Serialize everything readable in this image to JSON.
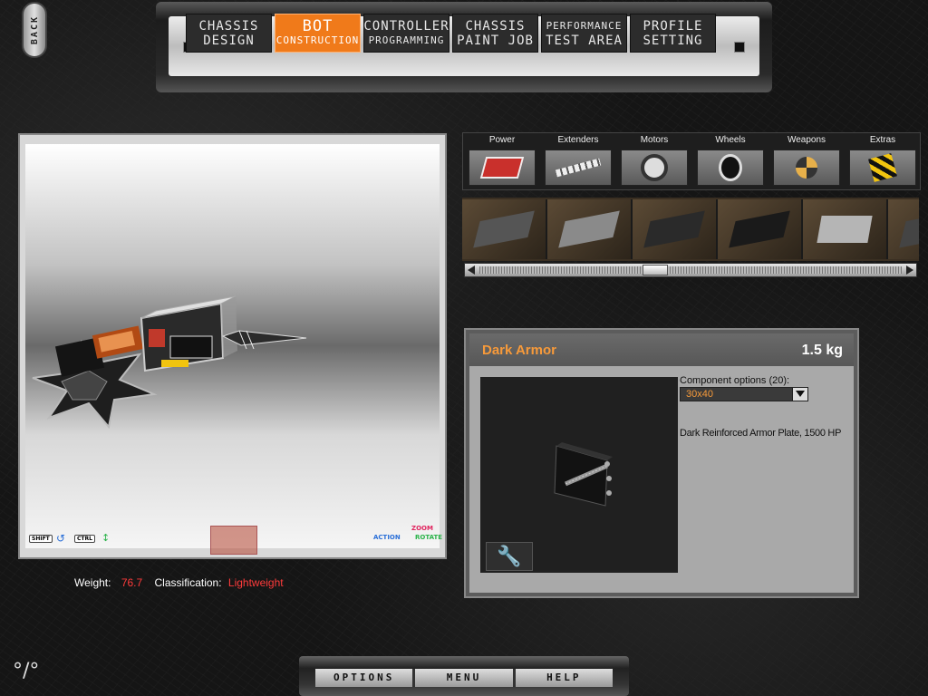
{
  "back": {
    "label": "BACK"
  },
  "nav": {
    "tabs": [
      {
        "line1": "CHASSIS",
        "line2": "DESIGN"
      },
      {
        "line1": "BOT",
        "line2": "CONSTRUCTION",
        "active": true
      },
      {
        "line1": "CONTROLLER",
        "line2": "PROGRAMMING"
      },
      {
        "line1": "CHASSIS",
        "line2": "PAINT JOB"
      },
      {
        "line1": "PERFORMANCE",
        "line2": "TEST AREA"
      },
      {
        "line1": "PROFILE",
        "line2": "SETTING"
      }
    ]
  },
  "viewport": {
    "hints": {
      "shift": "SHIFT",
      "ctrl": "CTRL",
      "action": "ACTION",
      "zoom": "ZOOM",
      "rotate": "ROTATE"
    }
  },
  "stats": {
    "weight_label": "Weight:",
    "weight_value": "76.7",
    "class_label": "Classification:",
    "class_value": "Lightweight"
  },
  "categories": [
    {
      "label": "Power",
      "icon": "battery-icon"
    },
    {
      "label": "Extenders",
      "icon": "extender-icon"
    },
    {
      "label": "Motors",
      "icon": "motor-icon"
    },
    {
      "label": "Wheels",
      "icon": "wheel-icon"
    },
    {
      "label": "Weapons",
      "icon": "saw-icon"
    },
    {
      "label": "Extras",
      "icon": "hazard-icon"
    }
  ],
  "part": {
    "name": "Dark Armor",
    "mass": "1.5 kg",
    "options_label": "Component options (20):",
    "selected_option": "30x40",
    "description": "Dark Reinforced Armor Plate, 1500 HP"
  },
  "bottom_menu": {
    "options": "OPTIONS",
    "menu": "MENU",
    "help": "HELP"
  },
  "colors": {
    "accent": "#f07a1a",
    "title": "#f79a3a",
    "alert": "#ff3b3b"
  }
}
